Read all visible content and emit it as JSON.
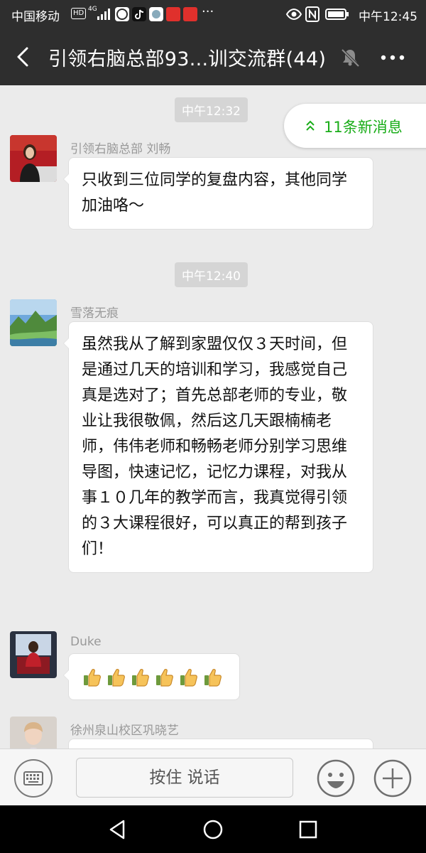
{
  "status_bar": {
    "carrier": "中国移动",
    "hd": "HD",
    "network": "4G",
    "time": "中午12:45",
    "more": "···",
    "apps": [
      {
        "name": "头条",
        "color": "#e0302c"
      },
      {
        "name": "小红书",
        "color": "#e0302c"
      }
    ]
  },
  "header": {
    "title": "引领右脑总部93...训交流群(44)",
    "muted": true
  },
  "new_messages": {
    "label": "11条新消息"
  },
  "messages": [
    {
      "type": "time",
      "text": "中午12:32"
    },
    {
      "type": "text",
      "sender": "引领右脑总部 刘畅",
      "text": "只收到三位同学的复盘内容，其他同学加油咯～"
    },
    {
      "type": "time",
      "text": "中午12:40"
    },
    {
      "type": "text",
      "sender": "雪落无痕",
      "text": "虽然我从了解到家盟仅仅３天时间，但是通过几天的培训和学习，我感觉自己真是选对了；首先总部老师的专业，敬业让我很敬佩，然后这几天跟楠楠老师，伟伟老师和畅畅老师分别学习思维导图，快速记忆，记忆力课程，对我从事１０几年的教学而言，我真觉得引领的３大课程很好，可以真正的帮到孩子们！"
    },
    {
      "type": "emoji",
      "sender": "Duke",
      "emoji_count": 6,
      "emoji_name": "thumbs-up-icon"
    },
    {
      "type": "text",
      "sender": "徐州泉山校区巩晓艺"
    }
  ],
  "input_bar": {
    "voice_label": "按住 说话"
  },
  "colors": {
    "header_bg": "#2e2e2e",
    "chat_bg": "#ebebeb",
    "accent_green": "#1aad19",
    "time_badge": "#d5d5d5"
  }
}
